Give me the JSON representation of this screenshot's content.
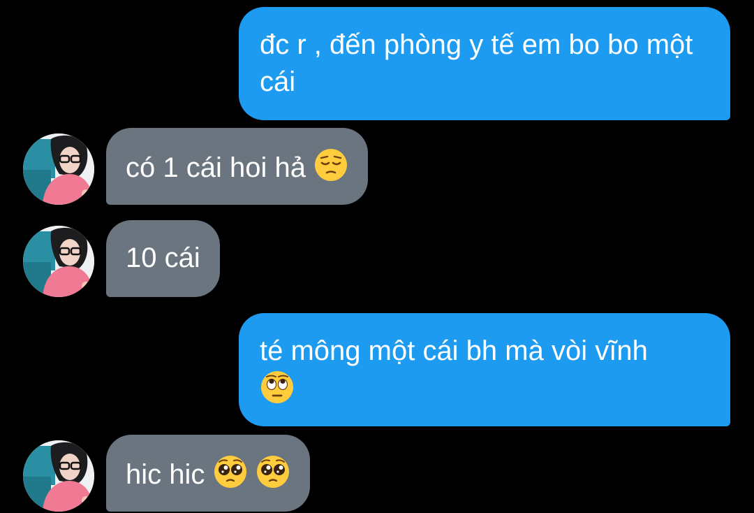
{
  "messages": {
    "m1": {
      "text": "đc r , đến phòng y tế em bo bo một cái"
    },
    "m2": {
      "text": "có 1 cái hoi hả"
    },
    "m3": {
      "text": "10 cái"
    },
    "m4": {
      "text": "té mông một cái bh mà vòi vĩnh"
    },
    "m5": {
      "text": "hic hic"
    }
  },
  "emoji": {
    "m2": "pensive-face",
    "m4": "face-with-rolling-eyes",
    "m5": [
      "pleading-face",
      "pleading-face"
    ]
  },
  "colors": {
    "background": "#000000",
    "outgoing_bubble": "#1d9bf0",
    "incoming_bubble": "#6a7580",
    "text": "#ffffff"
  }
}
